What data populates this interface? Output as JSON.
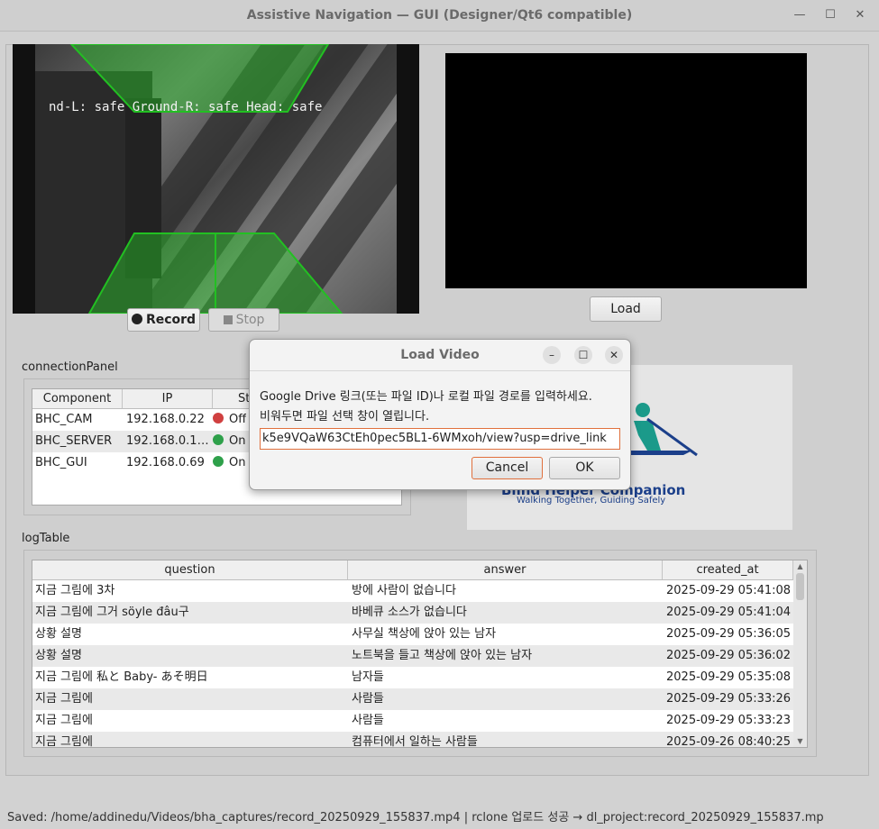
{
  "window": {
    "title": "Assistive Navigation — GUI (Designer/Qt6 compatible)"
  },
  "camera": {
    "overlay_text": "nd-L: safe  Ground-R: safe  Head: safe"
  },
  "controls": {
    "record_label": "Record",
    "stop_label": "Stop",
    "load_label": "Load"
  },
  "connection_panel": {
    "label": "connectionPanel",
    "headers": [
      "Component",
      "IP",
      "St"
    ],
    "rows": [
      {
        "component": "BHC_CAM",
        "ip": "192.168.0.22",
        "status": "Off",
        "color": "#d04040"
      },
      {
        "component": "BHC_SERVER",
        "ip": "192.168.0.1…",
        "status": "On",
        "color": "#2ea04a"
      },
      {
        "component": "BHC_GUI",
        "ip": "192.168.0.69",
        "status": "On",
        "color": "#2ea04a"
      }
    ]
  },
  "dialog": {
    "title": "Load Video",
    "line1": "Google Drive 링크(또는 파일 ID)나 로컬 파일 경로를 입력하세요.",
    "line2": "비워두면 파일 선택 창이 열립니다.",
    "input_value": "k5e9VQaW63CtEh0pec5BL1-6WMxoh/view?usp=drive_link",
    "cancel_label": "Cancel",
    "ok_label": "OK"
  },
  "logo": {
    "letters": "HC",
    "name": "Blind Helper Companion",
    "tagline": "Walking Together, Guiding Safely"
  },
  "log_table": {
    "label": "logTable",
    "headers": [
      "question",
      "answer",
      "created_at"
    ],
    "rows": [
      {
        "question": "지금 그림에  3차",
        "answer": "방에 사람이 없습니다",
        "created_at": "2025-09-29 05:41:08"
      },
      {
        "question": "지금 그림에  그거 söyle đâu구",
        "answer": "바베큐 소스가 없습니다",
        "created_at": "2025-09-29 05:41:04"
      },
      {
        "question": "상황 설명",
        "answer": "사무실 책상에 앉아 있는 남자",
        "created_at": "2025-09-29 05:36:05"
      },
      {
        "question": "상황 설명",
        "answer": "노트북을 들고 책상에 앉아 있는 남자",
        "created_at": "2025-09-29 05:36:02"
      },
      {
        "question": "지금 그림에 私と Baby- あそ明日",
        "answer": "남자들",
        "created_at": "2025-09-29 05:35:08"
      },
      {
        "question": "지금 그림에",
        "answer": "사람들",
        "created_at": "2025-09-29 05:33:26"
      },
      {
        "question": "지금 그림에",
        "answer": "사람들",
        "created_at": "2025-09-29 05:33:23"
      },
      {
        "question": "지금 그림에",
        "answer": "컴퓨터에서 일하는 사람들",
        "created_at": "2025-09-26 08:40:25"
      }
    ]
  },
  "status_bar": {
    "text": "Saved: /home/addinedu/Videos/bha_captures/record_20250929_155837.mp4 | rclone 업로드 성공 → dl_project:record_20250929_155837.mp"
  }
}
